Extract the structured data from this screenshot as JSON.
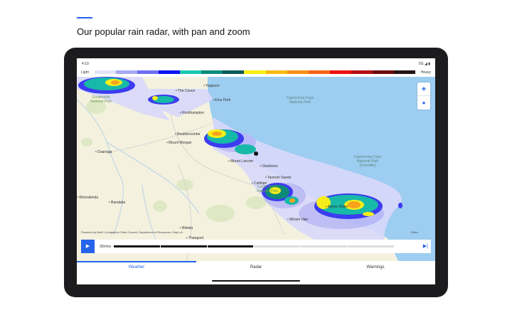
{
  "heading": "Our popular rain radar, with pan and zoom",
  "status": {
    "time": "4:10",
    "network": "5G ◢ ▮"
  },
  "legend": {
    "light": "Light",
    "heavy": "Heavy",
    "colors": [
      "#e2e2fb",
      "#a9a9f4",
      "#6e6ef1",
      "#0a14f0",
      "#19c8b4",
      "#0c8c7c",
      "#0b5a5a",
      "#f7ef13",
      "#f7bb10",
      "#f79015",
      "#f76414",
      "#ef1010",
      "#b40d14",
      "#6e0a0c",
      "#231313"
    ]
  },
  "map": {
    "labels": [
      "Yeppoon",
      "The Caves",
      "Emu Park",
      "Rockhampton",
      "Bouldercombe",
      "Mount Morgan",
      "Duaringa",
      "Mount Larcom",
      "Gladstone",
      "Tannum Sands",
      "Calliope",
      "Miriam Vale",
      "Agnes Water",
      "Woorabinda",
      "Baralaba",
      "Biloela",
      "Thangool",
      "Biloela"
    ],
    "parks": [
      "Goodedulla National Park",
      "Castle Tower National Park"
    ],
    "sea_parks": [
      "Capricornia Cays National Park",
      "Capricornia Cays National Park (Scientific)"
    ],
    "attribution": "Powered by BoM | Livingstone Shire Council, Department of Resources, Dept of...",
    "scale": "10km",
    "layers_icon": "layers-icon",
    "location_icon": "location-pin-icon"
  },
  "timeline": {
    "label": "30mins",
    "segments": [
      1,
      1,
      1,
      0,
      0,
      0
    ],
    "play_icon": "play-icon",
    "end_icon": "skip-to-end-icon"
  },
  "tabs": [
    {
      "label": "Weather"
    },
    {
      "label": "Radar"
    },
    {
      "label": "Warnings"
    }
  ]
}
